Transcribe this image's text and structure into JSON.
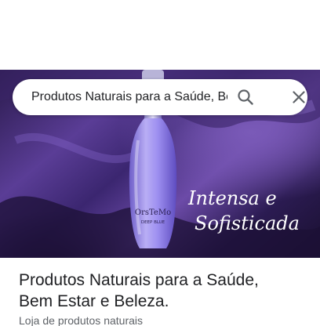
{
  "search": {
    "query": "Produtos Naturais para a Saúde, Bem"
  },
  "hero_image": {
    "product_brand": "OrsTeMo",
    "product_variant": "DEEP BLUE",
    "overlay_line1": "Intensa e",
    "overlay_line2": "Sofisticada"
  },
  "place": {
    "title_line1": "Produtos Naturais para a Saúde,",
    "title_line2": "Bem Estar e Beleza.",
    "category": "Loja de produtos naturais"
  },
  "icons": {
    "search": "search-icon",
    "close": "close-icon"
  },
  "colors": {
    "icon_gray": "#5f6368",
    "title_text": "#202124",
    "secondary_text": "#5f6368",
    "hero_purple": "#5a3d96"
  }
}
